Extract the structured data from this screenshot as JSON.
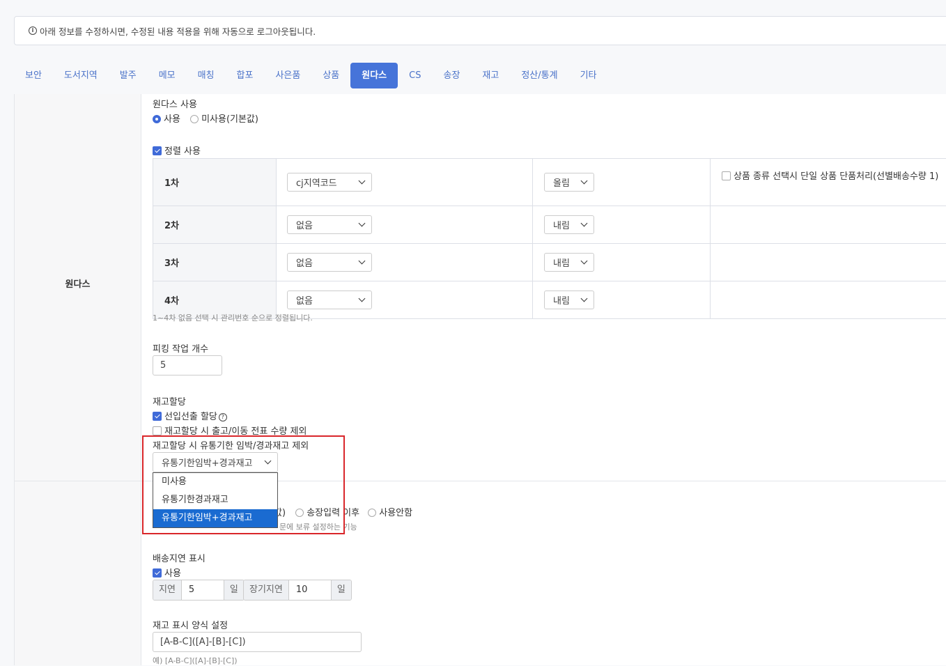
{
  "notice": {
    "icon": "info-circle-icon",
    "text": "아래 정보를 수정하시면, 수정된 내용 적용을 위해 자동으로 로그아웃됩니다."
  },
  "tabs": [
    {
      "label": "보안",
      "active": false
    },
    {
      "label": "도서지역",
      "active": false
    },
    {
      "label": "발주",
      "active": false
    },
    {
      "label": "메모",
      "active": false
    },
    {
      "label": "매칭",
      "active": false
    },
    {
      "label": "합포",
      "active": false
    },
    {
      "label": "사은품",
      "active": false
    },
    {
      "label": "상품",
      "active": false
    },
    {
      "label": "원다스",
      "active": true
    },
    {
      "label": "CS",
      "active": false
    },
    {
      "label": "송장",
      "active": false
    },
    {
      "label": "재고",
      "active": false
    },
    {
      "label": "정산/통계",
      "active": false
    },
    {
      "label": "기타",
      "active": false
    }
  ],
  "section": {
    "label": "원다스"
  },
  "wondas_use": {
    "title": "원다스 사용",
    "options": [
      "사용",
      "미사용(기본값)"
    ],
    "selected": "사용"
  },
  "sort": {
    "checkbox_label": "정렬 사용",
    "checked": true,
    "rows": [
      {
        "rank": "1차",
        "field": "cj지역코드",
        "order": "올림"
      },
      {
        "rank": "2차",
        "field": "없음",
        "order": "내림"
      },
      {
        "rank": "3차",
        "field": "없음",
        "order": "내림"
      },
      {
        "rank": "4차",
        "field": "없음",
        "order": "내림"
      }
    ],
    "single_item_label": "상품 종류 선택시 단일 상품 단품처리(선별배송수량 1)",
    "single_item_checked": false,
    "hint": "1~4차 없음 선택 시 관리번호 순으로 정렬됩니다."
  },
  "picking": {
    "title": "피킹 작업 개수",
    "value": "5"
  },
  "stock_alloc": {
    "title": "재고할당",
    "fifo_label": "선입선출 할당",
    "fifo_checked": true,
    "fifo_help_icon": "question-circle-icon",
    "exclude_transfer_label": "재고할당 시 출고/이동 전표 수량 제외",
    "exclude_transfer_checked": false,
    "expiry_title": "재고할당 시 유통기한 임박/경과재고 제외",
    "expiry_selected": "유통기한임박+경과재고",
    "expiry_options": [
      "미사용",
      "유통기한경과재고",
      "유통기한임박+경과재고"
    ],
    "accent_color": "#d9262a"
  },
  "hold_partial": {
    "option_tail": "값)",
    "options": [
      "송장입력 이후",
      "사용안함"
    ],
    "hint_partial": "문에 보류 설정하는 기능"
  },
  "delay": {
    "title": "배송지연 표시",
    "checkbox_label": "사용",
    "checked": true,
    "delay_label": "지연",
    "delay_value": "5",
    "long_label": "장기지연",
    "long_value": "10",
    "unit": "일"
  },
  "stock_format": {
    "title": "재고 표시 양식 설정",
    "value": "[A-B-C]([A]-[B]-[C])",
    "example": "예) [A-B-C]([A]-[B]-[C])"
  }
}
